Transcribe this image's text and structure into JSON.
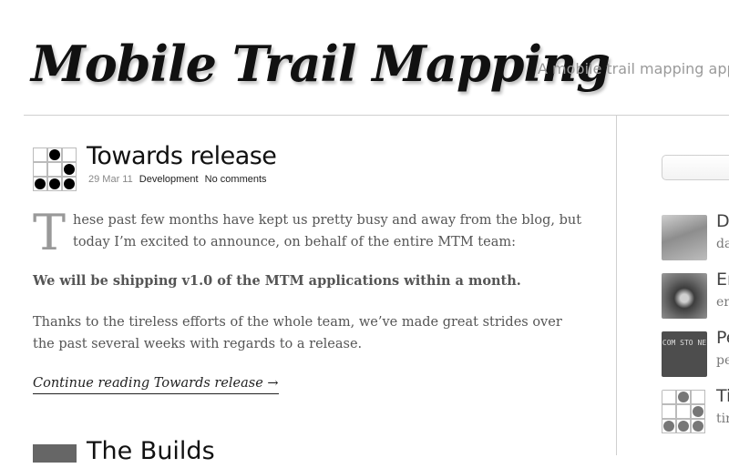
{
  "header": {
    "site_title": "Mobile Trail Mapping",
    "tagline": "A mobile trail mapping applica"
  },
  "post": {
    "title": "Towards release",
    "date": "29 Mar 11",
    "category": "Development",
    "comments": "No comments",
    "dropcap": "T",
    "para1_line1": "hese past few months have kept us pretty busy and away from the blog, but",
    "para1_line2": "today I’m excited to announce, on behalf of the entire MTM team:",
    "para2": "We will be shipping v1.0 of the MTM applications within a month.",
    "para3": "Thanks to the tireless efforts of the whole team, we’ve made great strides over the past several weeks with regards to a release.",
    "continue_link": "Continue reading Towards release →"
  },
  "post2": {
    "title": "The Builds"
  },
  "sidebar": {
    "authors": [
      {
        "name": "Da",
        "handle": "da"
      },
      {
        "name": "Er",
        "handle": "er"
      },
      {
        "name": "Pe",
        "handle": "pe"
      },
      {
        "name": "Ti",
        "handle": "tir"
      }
    ],
    "avatar3_text": "COM STO NE"
  }
}
